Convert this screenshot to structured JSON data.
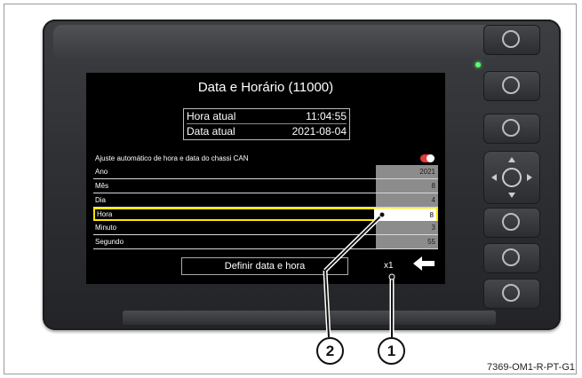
{
  "screen": {
    "title": "Data e Horário (11000)",
    "current": [
      {
        "label": "Hora atual",
        "value": "11:04:55"
      },
      {
        "label": "Data atual",
        "value": "2021-08-04"
      }
    ],
    "auto_adjust_label": "Ajuste automático de hora e data do chassi CAN",
    "auto_adjust_on": true,
    "fields": [
      {
        "label": "Ano",
        "value": "2021"
      },
      {
        "label": "Mês",
        "value": "8"
      },
      {
        "label": "Dia",
        "value": "4"
      },
      {
        "label": "Hora",
        "value": "8",
        "selected": true
      },
      {
        "label": "Minuto",
        "value": "3"
      },
      {
        "label": "Segundo",
        "value": "55"
      }
    ],
    "set_button": "Definir data e hora",
    "step_label": "x1",
    "back_icon": "arrow-left-icon"
  },
  "callouts": [
    "1",
    "2"
  ],
  "reference": "7369-OM1-R-PT-G1",
  "colors": {
    "highlight": "#ffe600",
    "toggle": "#e23b3b",
    "led": "#5dff6a"
  }
}
